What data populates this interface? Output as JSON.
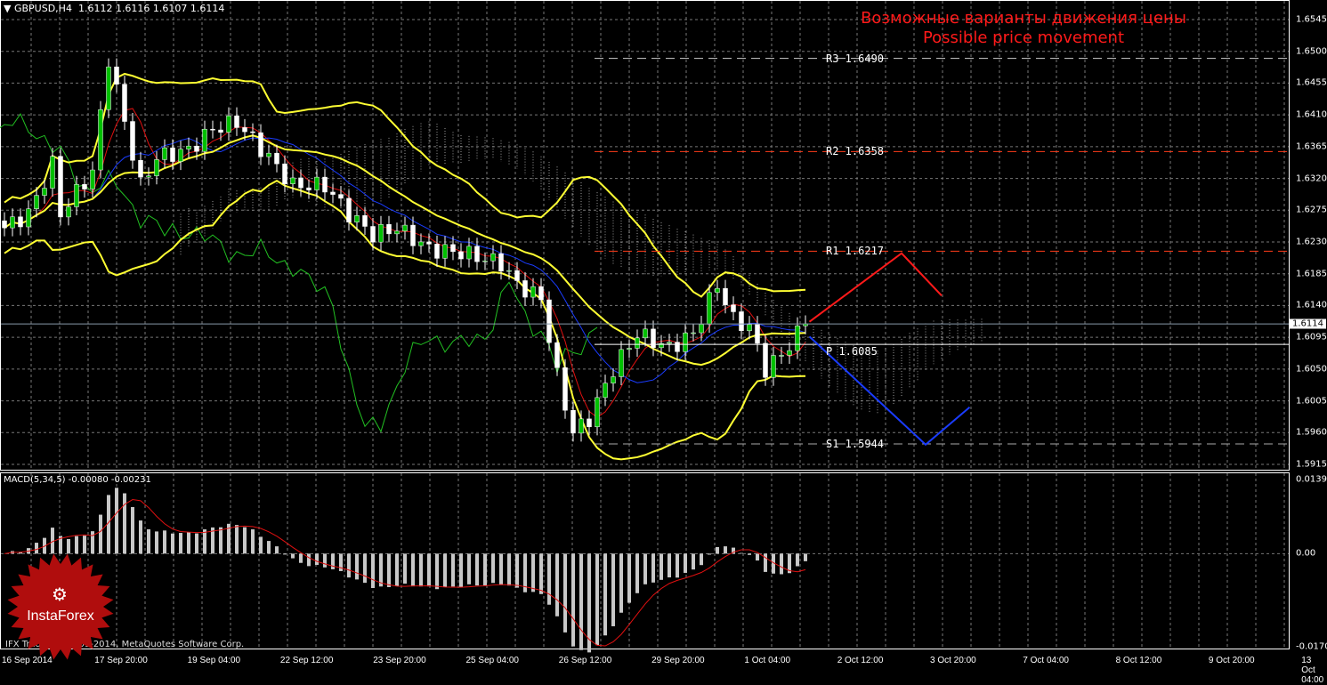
{
  "header": {
    "symbol": "GBPUSD,H4",
    "ohlc": "1.6112 1.6116 1.6107 1.6114"
  },
  "forecast_title": {
    "ru": "Возможные варианты движения цены",
    "en": "Possible price movement"
  },
  "price_axis": {
    "ticks": [
      "1.6545",
      "1.6500",
      "1.6455",
      "1.6410",
      "1.6365",
      "1.6320",
      "1.6275",
      "1.6230",
      "1.6185",
      "1.6140",
      "1.6095",
      "1.6050",
      "1.6005",
      "1.5960",
      "1.5915"
    ],
    "current": "1.6114"
  },
  "macd_axis": {
    "ticks": [
      "0.01391",
      "0.00",
      "-0.01706"
    ]
  },
  "macd_label": "MACD(5,34,5) -0.00080 -0.00231",
  "time_axis": [
    "16 Sep 2014",
    "17 Sep 20:00",
    "19 Sep 04:00",
    "22 Sep 12:00",
    "23 Sep 20:00",
    "25 Sep 04:00",
    "26 Sep 12:00",
    "29 Sep 20:00",
    "1 Oct 04:00",
    "2 Oct 12:00",
    "3 Oct 20:00",
    "7 Oct 04:00",
    "8 Oct 12:00",
    "9 Oct 20:00",
    "13 Oct 04:00"
  ],
  "levels": [
    {
      "name": "R3",
      "label": "R3 1.6490",
      "price": 1.649,
      "color": "#cccccc",
      "style": "dashed"
    },
    {
      "name": "R2",
      "label": "R2 1.6358",
      "price": 1.6358,
      "color": "#ff3b1a",
      "style": "dashed"
    },
    {
      "name": "R1",
      "label": "R1 1.6217",
      "price": 1.6217,
      "color": "#ff3b1a",
      "style": "dashed"
    },
    {
      "name": "P",
      "label": "P 1.6085",
      "price": 1.6085,
      "color": "#ffffff",
      "style": "solid"
    },
    {
      "name": "S1",
      "label": "S1 1.5944",
      "price": 1.5944,
      "color": "#aaaaaa",
      "style": "dashed"
    }
  ],
  "chart_data": {
    "type": "candlestick",
    "price_range": [
      1.5915,
      1.6545
    ],
    "macd_range": [
      -0.01706,
      0.01391
    ],
    "price_path": [
      [
        0,
        1.625
      ],
      [
        3,
        1.627
      ],
      [
        6,
        1.634
      ],
      [
        7,
        1.627
      ],
      [
        11,
        1.633
      ],
      [
        13,
        1.649
      ],
      [
        15,
        1.64
      ],
      [
        17,
        1.631
      ],
      [
        19,
        1.635
      ],
      [
        23,
        1.636
      ],
      [
        26,
        1.639
      ],
      [
        29,
        1.64
      ],
      [
        33,
        1.635
      ],
      [
        36,
        1.631
      ],
      [
        40,
        1.631
      ],
      [
        43,
        1.627
      ],
      [
        46,
        1.624
      ],
      [
        49,
        1.625
      ],
      [
        53,
        1.622
      ],
      [
        57,
        1.6215
      ],
      [
        62,
        1.62
      ],
      [
        64,
        1.617
      ],
      [
        67,
        1.615
      ],
      [
        69,
        1.604
      ],
      [
        71,
        1.596
      ],
      [
        73,
        1.598
      ],
      [
        76,
        1.605
      ],
      [
        79,
        1.61
      ],
      [
        83,
        1.608
      ],
      [
        86,
        1.61
      ],
      [
        89,
        1.617
      ],
      [
        91,
        1.612
      ],
      [
        93,
        1.611
      ],
      [
        95,
        1.605
      ],
      [
        97,
        1.607
      ],
      [
        100,
        1.6114
      ]
    ],
    "forecast_up": [
      [
        100.5,
        1.6117
      ],
      [
        112,
        1.6214
      ],
      [
        117,
        1.6154
      ]
    ],
    "forecast_down": [
      [
        100.5,
        1.6096
      ],
      [
        115,
        1.5943
      ],
      [
        120.5,
        1.5996
      ]
    ]
  },
  "watermark": {
    "brand": "InstaForex"
  },
  "footer": "IFX Trader, © 2001-2014, MetaQuotes Software Corp."
}
